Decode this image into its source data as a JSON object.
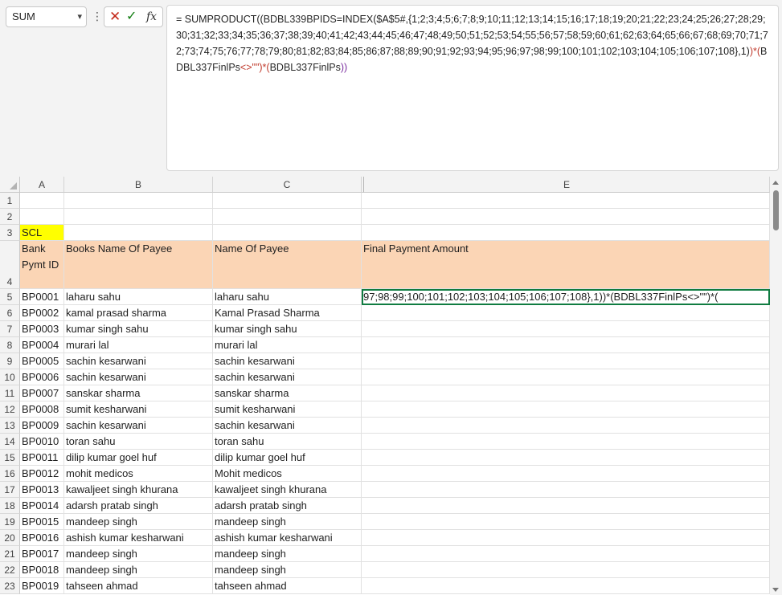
{
  "name_box": {
    "value": "SUM"
  },
  "formula_bar": {
    "cancel_glyph": "✕",
    "enter_glyph": "✓",
    "fx_label": "fx",
    "p1": "= SUMPRODUCT((",
    "p2": "BDBL339BPIDS",
    "p3": "=INDEX($A$5#,{1;2;3;4;5;6;7;8;9;10;11;12;13;14;15;16;17;18;19;20;21;22;23;24;25;26;27;28;29;30;31;32;33;34;35;36;37;38;39;40;41;42;43;44;45;46;47;48;49;50;51;52;53;54;55;56;57;58;59;60;61;62;63;64;65;66;67;68;69;70;71;72;73;74;75;76;77;78;79;80;81;82;83;84;85;86;87;88;89;90;91;92;93;94;95;96;97;98;99;100;101;102;103;104;105;106;107;108},1)",
    "p4": ")*(",
    "p5": "BDBL337FinlPs",
    "p6": "<>\"\")*(",
    "p7": "BDBL337FinlPs",
    "p8": "))"
  },
  "columns": [
    {
      "letter": "A"
    },
    {
      "letter": "B"
    },
    {
      "letter": "C"
    },
    {
      "letter": "E"
    }
  ],
  "row3": {
    "num": "3",
    "a": "SCL"
  },
  "row4": {
    "num": "4",
    "a": "Bank Pymt ID",
    "b": "Books Name Of Payee",
    "c": "Name Of Payee",
    "e": "Final Payment Amount"
  },
  "row5_e": "97;98;99;100;101;102;103;104;105;106;107;108},1))*(BDBL337FinlPs<>\"\")*(",
  "rows": [
    {
      "num": "5",
      "id": "BP0001",
      "books": "laharu sahu",
      "payee": "laharu sahu"
    },
    {
      "num": "6",
      "id": "BP0002",
      "books": "kamal prasad sharma",
      "payee": "Kamal Prasad Sharma"
    },
    {
      "num": "7",
      "id": "BP0003",
      "books": "kumar singh sahu",
      "payee": "kumar singh sahu"
    },
    {
      "num": "8",
      "id": "BP0004",
      "books": "murari lal",
      "payee": "murari lal"
    },
    {
      "num": "9",
      "id": "BP0005",
      "books": "sachin kesarwani",
      "payee": "sachin kesarwani"
    },
    {
      "num": "10",
      "id": "BP0006",
      "books": "sachin kesarwani",
      "payee": "sachin kesarwani"
    },
    {
      "num": "11",
      "id": "BP0007",
      "books": "sanskar sharma",
      "payee": "sanskar sharma"
    },
    {
      "num": "12",
      "id": "BP0008",
      "books": "sumit kesharwani",
      "payee": "sumit kesharwani"
    },
    {
      "num": "13",
      "id": "BP0009",
      "books": "sachin kesarwani",
      "payee": "sachin kesarwani"
    },
    {
      "num": "14",
      "id": "BP0010",
      "books": "toran sahu",
      "payee": "toran sahu"
    },
    {
      "num": "15",
      "id": "BP0011",
      "books": "dilip kumar goel huf",
      "payee": "dilip kumar goel huf"
    },
    {
      "num": "16",
      "id": "BP0012",
      "books": "mohit medicos",
      "payee": "Mohit medicos"
    },
    {
      "num": "17",
      "id": "BP0013",
      "books": "kawaljeet singh khurana",
      "payee": "kawaljeet singh khurana"
    },
    {
      "num": "18",
      "id": "BP0014",
      "books": "adarsh pratab singh",
      "payee": "adarsh pratab singh"
    },
    {
      "num": "19",
      "id": "BP0015",
      "books": "mandeep singh",
      "payee": "mandeep singh"
    },
    {
      "num": "20",
      "id": "BP0016",
      "books": "ashish kumar kesharwani",
      "payee": "ashish kumar kesharwani"
    },
    {
      "num": "21",
      "id": "BP0017",
      "books": "mandeep singh",
      "payee": "mandeep singh"
    },
    {
      "num": "22",
      "id": "BP0018",
      "books": "mandeep singh",
      "payee": "mandeep singh"
    },
    {
      "num": "23",
      "id": "BP0019",
      "books": "tahseen ahmad",
      "payee": "tahseen ahmad"
    }
  ],
  "empty_rows": [
    {
      "num": "1"
    },
    {
      "num": "2"
    }
  ]
}
